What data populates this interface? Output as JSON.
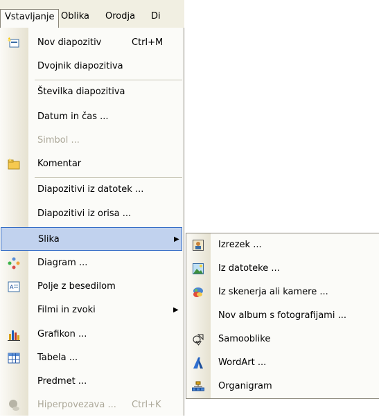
{
  "menubar": {
    "items": [
      "Vstavljanje",
      "Oblika",
      "Orodja",
      "Di"
    ]
  },
  "menu": {
    "items": [
      {
        "label": "Nov diapozitiv",
        "shortcut": "Ctrl+M",
        "icon": "new-slide-icon"
      },
      {
        "label": "Dvojnik diapozitiva"
      },
      {
        "label": "Številka diapozitiva"
      },
      {
        "label": "Datum in čas ..."
      },
      {
        "label": "Simbol ...",
        "disabled": true
      },
      {
        "label": "Komentar",
        "icon": "comment-icon"
      },
      {
        "label": "Diapozitivi iz datotek ..."
      },
      {
        "label": "Diapozitivi iz orisa ..."
      },
      {
        "label": "Slika",
        "submenu": true,
        "highlighted": true
      },
      {
        "label": "Diagram ...",
        "icon": "diagram-icon"
      },
      {
        "label": "Polje z besedilom",
        "icon": "textbox-icon"
      },
      {
        "label": "Filmi in zvoki",
        "submenu": true
      },
      {
        "label": "Grafikon ...",
        "icon": "chart-icon"
      },
      {
        "label": "Tabela ...",
        "icon": "table-icon"
      },
      {
        "label": "Predmet ..."
      },
      {
        "label": "Hiperpovezava ...",
        "shortcut": "Ctrl+K",
        "icon": "hyperlink-icon",
        "disabled": true
      }
    ]
  },
  "submenu": {
    "items": [
      {
        "label": "Izrezek ...",
        "icon": "clipart-icon"
      },
      {
        "label": "Iz datoteke ...",
        "icon": "picture-from-file-icon"
      },
      {
        "label": "Iz skenerja ali kamere ...",
        "icon": "scanner-camera-icon"
      },
      {
        "label": "Nov album s fotografijami ..."
      },
      {
        "label": "Samooblike",
        "icon": "autoshapes-icon"
      },
      {
        "label": "WordArt ...",
        "icon": "wordart-icon"
      },
      {
        "label": "Organigram",
        "icon": "org-chart-icon"
      }
    ]
  },
  "colors": {
    "menu_bg": "#fbfbf8",
    "highlight_bg": "#c1d2ee",
    "highlight_border": "#316ac5",
    "disabled_text": "#aca899"
  }
}
